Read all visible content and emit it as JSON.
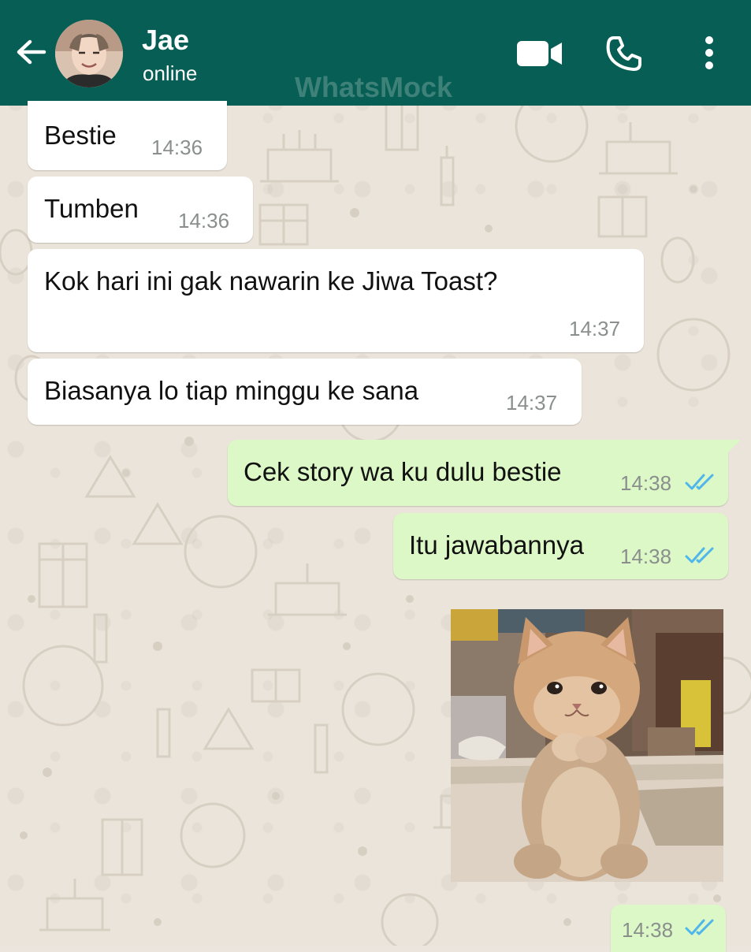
{
  "header": {
    "contact_name": "Jae",
    "status": "online",
    "watermark": "WhatsMock",
    "colors": {
      "bar": "#075e54",
      "incoming": "#ffffff",
      "outgoing": "#dcf8c6",
      "read_ticks": "#4fb6ec"
    },
    "icons": [
      "back-arrow-icon",
      "video-call-icon",
      "phone-icon",
      "more-vert-icon"
    ]
  },
  "messages": [
    {
      "direction": "in",
      "text": "Bestie",
      "time": "14:36"
    },
    {
      "direction": "in",
      "text": "Tumben",
      "time": "14:36"
    },
    {
      "direction": "in",
      "text": "Kok hari ini gak nawarin ke Jiwa Toast?",
      "time": "14:37"
    },
    {
      "direction": "in",
      "text": "Biasanya lo tiap minggu ke sana",
      "time": "14:37"
    },
    {
      "direction": "out",
      "text": "Cek story wa ku dulu bestie",
      "time": "14:38",
      "status": "read"
    },
    {
      "direction": "out",
      "text": "Itu jawabannya",
      "time": "14:38",
      "status": "read"
    },
    {
      "direction": "out",
      "type": "image",
      "image": "photo of a fluffy orange kitten sitting on a floor mat",
      "time": "14:38",
      "status": "read"
    }
  ]
}
